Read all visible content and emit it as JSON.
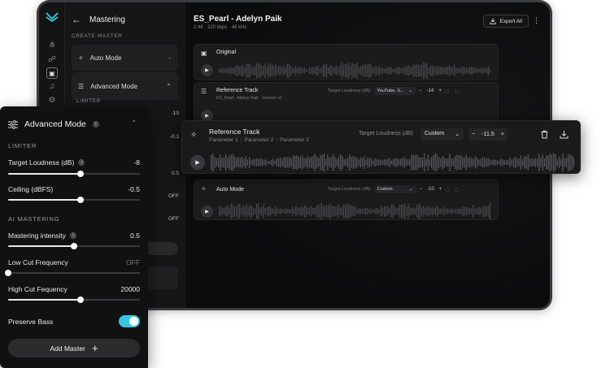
{
  "app": {
    "panel_title": "Mastering",
    "create_master_label": "CREATE MASTER",
    "auto_mode_label": "Auto Mode",
    "advanced_mode_label": "Advanced Mode",
    "limiter_label": "LIMITER",
    "bg_values": [
      "-10",
      "-0.3",
      "0.5",
      "OFF",
      "OFF"
    ]
  },
  "header": {
    "song_title": "ES_Pearl - Adelyn Paik",
    "song_meta": "2:46 · 320 kbps · 48 kHz",
    "export_label": "Export All"
  },
  "tracks": {
    "original": {
      "name": "Original"
    },
    "reference": {
      "name": "Reference Track",
      "sub": "ES_Pearl - Adelyn Paik · Version: v1",
      "loudness_label": "Target Loudness (dB)",
      "preset": "YouTube, S...",
      "value": "-14"
    },
    "auto": {
      "name": "Auto Mode",
      "loudness_label": "Target Loudness (dB)",
      "preset": "Custom",
      "value": "-10"
    }
  },
  "floating_reference": {
    "name": "Reference Track",
    "params": [
      "Parameter 1",
      "Parameter 2",
      "Parameter 3"
    ],
    "loudness_label": "Target Loudness (dB)",
    "preset": "Custom",
    "value": "-11.5"
  },
  "advanced": {
    "title": "Advanced Mode",
    "limiter_label": "LIMITER",
    "ai_label": "AI MASTERING",
    "target_loudness": {
      "label": "Target Loudness (dB)",
      "value": "-8",
      "level": 0.55
    },
    "ceiling": {
      "label": "Ceiling (dBFS)",
      "value": "-0.5",
      "level": 0.55
    },
    "intensity": {
      "label": "Mastering intensity",
      "value": "0.5",
      "level": 0.5
    },
    "low_cut": {
      "label": "Low Cut Frequency",
      "value": "OFF",
      "level": 0.0
    },
    "high_cut": {
      "label": "High Cut Fequency",
      "value": "20000",
      "level": 0.55
    },
    "preserve_bass": {
      "label": "Preserve Bass",
      "on": true
    },
    "add_master_label": "Add Master"
  },
  "colors": {
    "accent": "#3ac7e3",
    "background": "#0e0e0f",
    "panel": "#111112"
  },
  "icons": [
    "logo-icon",
    "back-arrow-icon",
    "sparkle-icon",
    "sliders-icon",
    "chevron-up-icon",
    "info-icon",
    "export-icon",
    "more-icon",
    "play-icon",
    "trash-icon",
    "download-icon",
    "plus-icon"
  ]
}
